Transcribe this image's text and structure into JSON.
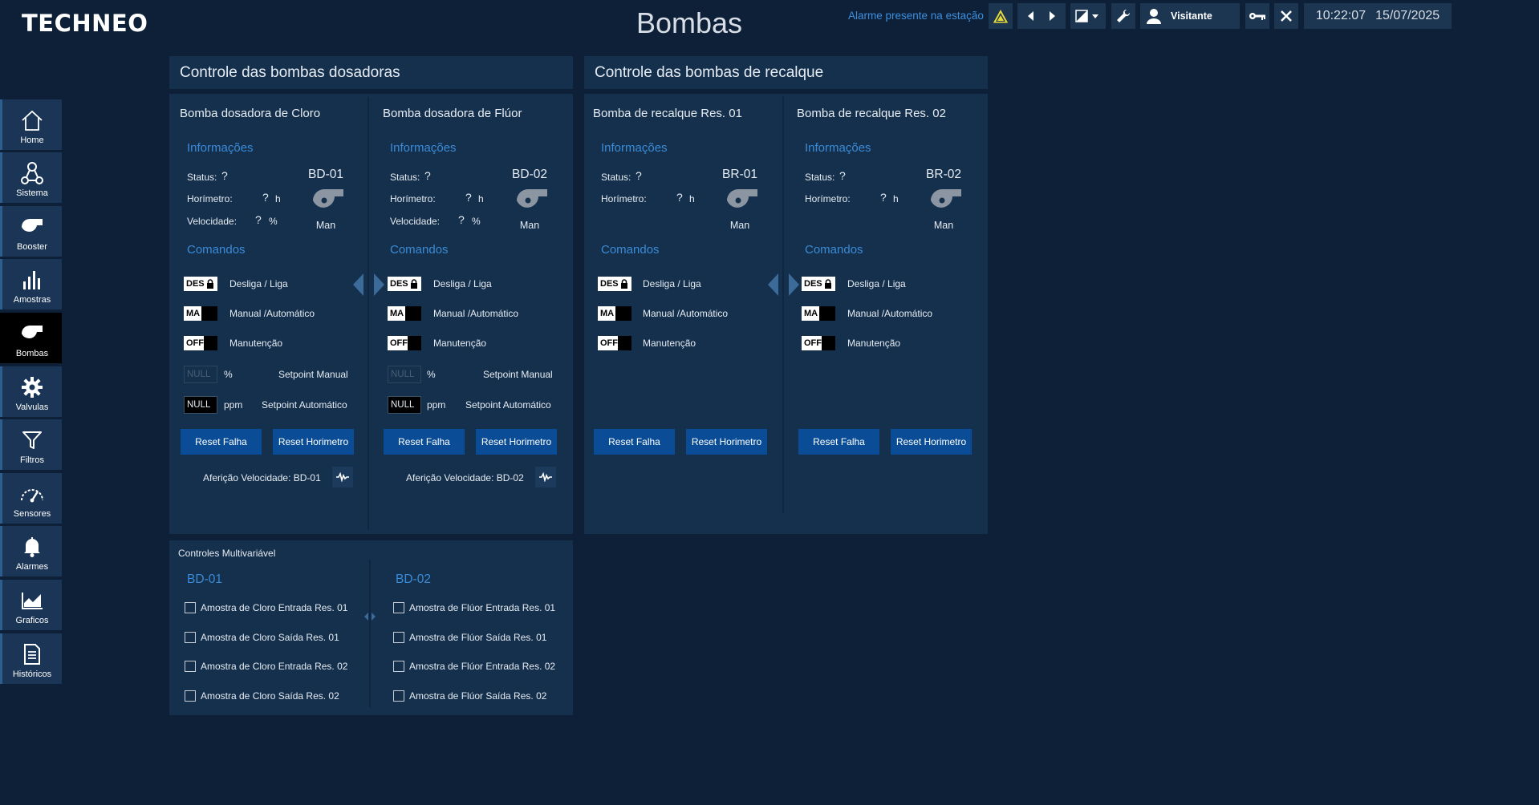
{
  "header": {
    "logo": "TECHNEO",
    "title": "Bombas",
    "alarm_text": "Alarme presente na estação",
    "user": "Visitante",
    "time": "10:22:07",
    "date": "15/07/2025"
  },
  "sidebar": {
    "items": [
      {
        "label": "Home",
        "icon": "home-icon"
      },
      {
        "label": "Sistema",
        "icon": "network-icon"
      },
      {
        "label": "Booster",
        "icon": "pump-icon"
      },
      {
        "label": "Amostras",
        "icon": "bar-chart-icon"
      },
      {
        "label": "Bombas",
        "icon": "pump-icon"
      },
      {
        "label": "Valvulas",
        "icon": "gear-icon"
      },
      {
        "label": "Filtros",
        "icon": "filter-icon"
      },
      {
        "label": "Sensores",
        "icon": "gauge-icon"
      },
      {
        "label": "Alarmes",
        "icon": "bell-icon"
      },
      {
        "label": "Graficos",
        "icon": "area-chart-icon"
      },
      {
        "label": "Históricos",
        "icon": "document-icon"
      }
    ]
  },
  "dosadoras": {
    "title": "Controle das bombas dosadoras",
    "pumps": [
      {
        "name": "Bomba dosadora de Cloro",
        "info_title": "Informações",
        "status_label": "Status:",
        "status_value": "?",
        "horimetro_label": "Horímetro:",
        "horimetro_value": "?",
        "horimetro_unit": "h",
        "velocidade_label": "Velocidade:",
        "velocidade_value": "?",
        "velocidade_unit": "%",
        "id": "BD-01",
        "mode": "Man",
        "cmd_title": "Comandos",
        "cmd1_toggle": "DES",
        "cmd1_label": "Desliga / Liga",
        "cmd2_toggle": "MA",
        "cmd2_label": "Manual /Automático",
        "cmd3_toggle": "OFF",
        "cmd3_label": "Manutenção",
        "sp_manual_value": "NULL",
        "sp_manual_unit": "%",
        "sp_manual_label": "Setpoint Manual",
        "sp_auto_value": "NULL",
        "sp_auto_unit": "ppm",
        "sp_auto_label": "Setpoint Automático",
        "reset_falha": "Reset Falha",
        "reset_horimetro": "Reset Horimetro",
        "afericao": "Aferição Velocidade: BD-01"
      },
      {
        "name": "Bomba dosadora de Flúor",
        "info_title": "Informações",
        "status_label": "Status:",
        "status_value": "?",
        "horimetro_label": "Horímetro:",
        "horimetro_value": "?",
        "horimetro_unit": "h",
        "velocidade_label": "Velocidade:",
        "velocidade_value": "?",
        "velocidade_unit": "%",
        "id": "BD-02",
        "mode": "Man",
        "cmd_title": "Comandos",
        "cmd1_toggle": "DES",
        "cmd1_label": "Desliga / Liga",
        "cmd2_toggle": "MA",
        "cmd2_label": "Manual /Automático",
        "cmd3_toggle": "OFF",
        "cmd3_label": "Manutenção",
        "sp_manual_value": "NULL",
        "sp_manual_unit": "%",
        "sp_manual_label": "Setpoint Manual",
        "sp_auto_value": "NULL",
        "sp_auto_unit": "ppm",
        "sp_auto_label": "Setpoint Automático",
        "reset_falha": "Reset Falha",
        "reset_horimetro": "Reset Horimetro",
        "afericao": "Aferição Velocidade: BD-02"
      }
    ]
  },
  "recalque": {
    "title": "Controle das bombas de recalque",
    "pumps": [
      {
        "name": "Bomba de recalque Res. 01",
        "info_title": "Informações",
        "status_label": "Status:",
        "status_value": "?",
        "horimetro_label": "Horímetro:",
        "horimetro_value": "?",
        "horimetro_unit": "h",
        "id": "BR-01",
        "mode": "Man",
        "cmd_title": "Comandos",
        "cmd1_toggle": "DES",
        "cmd1_label": "Desliga / Liga",
        "cmd2_toggle": "MA",
        "cmd2_label": "Manual /Automático",
        "cmd3_toggle": "OFF",
        "cmd3_label": "Manutenção",
        "reset_falha": "Reset Falha",
        "reset_horimetro": "Reset Horimetro"
      },
      {
        "name": "Bomba de recalque Res. 02",
        "info_title": "Informações",
        "status_label": "Status:",
        "status_value": "?",
        "horimetro_label": "Horímetro:",
        "horimetro_value": "?",
        "horimetro_unit": "h",
        "id": "BR-02",
        "mode": "Man",
        "cmd_title": "Comandos",
        "cmd1_toggle": "DES",
        "cmd1_label": "Desliga / Liga",
        "cmd2_toggle": "MA",
        "cmd2_label": "Manual /Automático",
        "cmd3_toggle": "OFF",
        "cmd3_label": "Manutenção",
        "reset_falha": "Reset Falha",
        "reset_horimetro": "Reset Horimetro"
      }
    ]
  },
  "multivariavel": {
    "title": "Controles Multivariável",
    "columns": [
      {
        "heading": "BD-01",
        "items": [
          "Amostra de Cloro Entrada Res. 01",
          "Amostra de Cloro Saída Res. 01",
          "Amostra de Cloro Entrada Res. 02",
          "Amostra de Cloro Saída Res. 02"
        ]
      },
      {
        "heading": "BD-02",
        "items": [
          "Amostra de Flúor Entrada Res. 01",
          "Amostra de Flúor Saída Res. 01",
          "Amostra de Flúor Entrada Res. 02",
          "Amostra de Flúor Saída Res. 02"
        ]
      }
    ]
  },
  "colors": {
    "background": "#0e2038",
    "panel": "#15304c",
    "accent_blue": "#3a8bd8",
    "button_blue": "#0a4d96",
    "alarm_yellow": "#e8d93a"
  }
}
